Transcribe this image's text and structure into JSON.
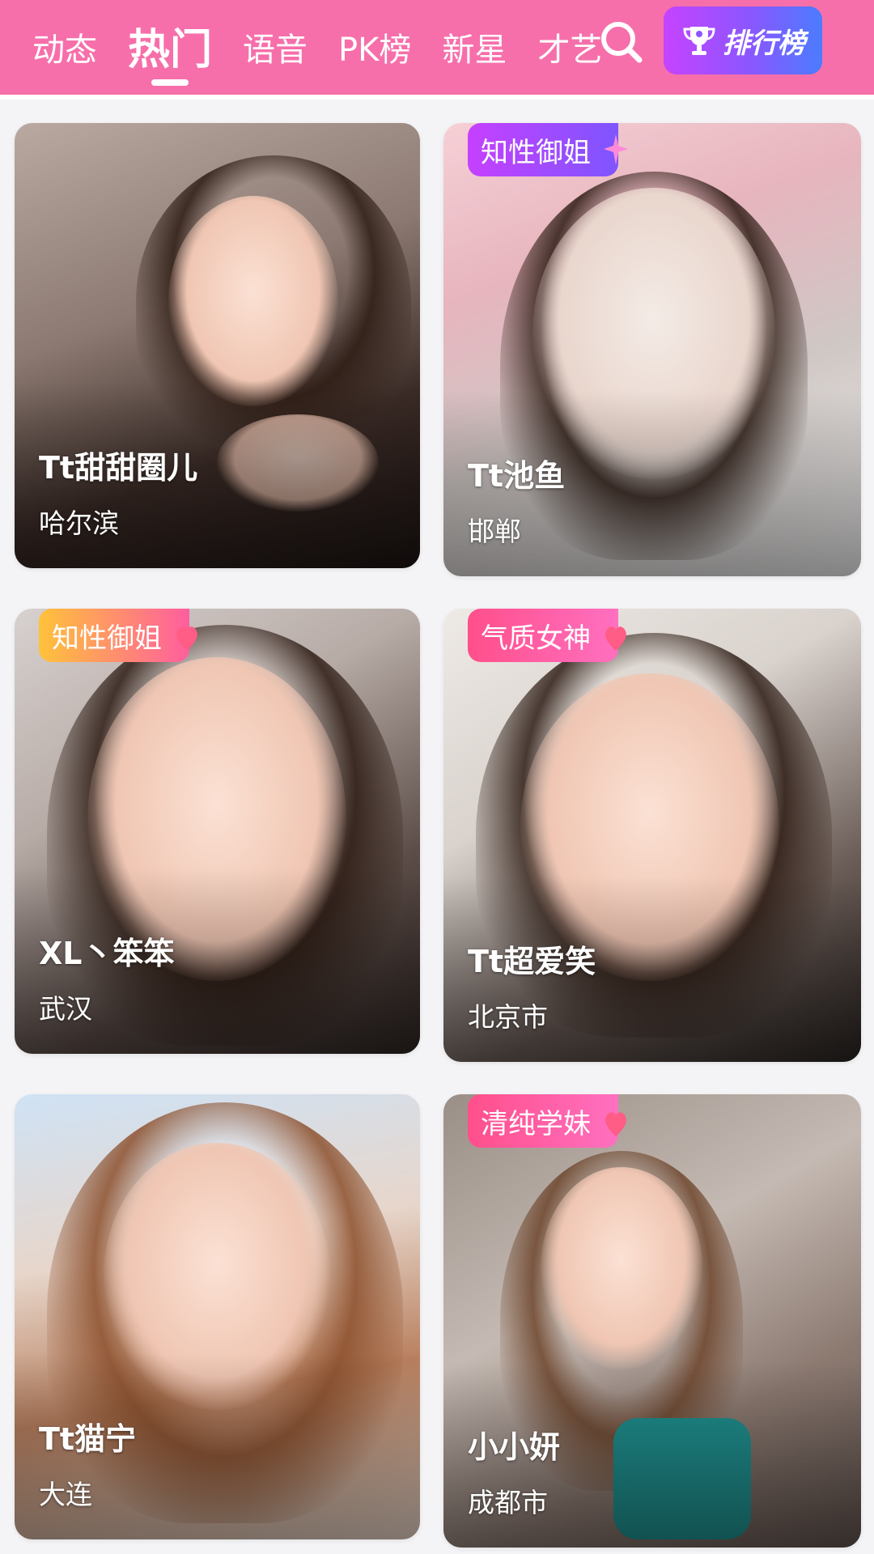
{
  "tabs": [
    {
      "label": "动态",
      "active": false
    },
    {
      "label": "热门",
      "active": true
    },
    {
      "label": "语音",
      "active": false
    },
    {
      "label": "PK榜",
      "active": false
    },
    {
      "label": "新星",
      "active": false
    },
    {
      "label": "才艺",
      "active": false
    }
  ],
  "search_icon": "search-icon",
  "rank_button": {
    "label": "排行榜",
    "icon": "trophy-icon"
  },
  "colors": {
    "topbar": "#f66faa",
    "badge_purple": "#c640ff",
    "badge_gold": "#ffc23a",
    "badge_pink": "#ff4f8b"
  },
  "cards": [
    {
      "name": "Tt甜甜圈儿",
      "city": "哈尔滨",
      "badge": ""
    },
    {
      "name": "Tt池鱼",
      "city": "邯郸",
      "badge": "知性御姐"
    },
    {
      "name": "XL丶笨笨",
      "city": "武汉",
      "badge": "知性御姐"
    },
    {
      "name": "Tt超爱笑",
      "city": "北京市",
      "badge": "气质女神"
    },
    {
      "name": "Tt猫宁",
      "city": "大连",
      "badge": ""
    },
    {
      "name": "小小妍",
      "city": "成都市",
      "badge": "清纯学妹"
    }
  ]
}
